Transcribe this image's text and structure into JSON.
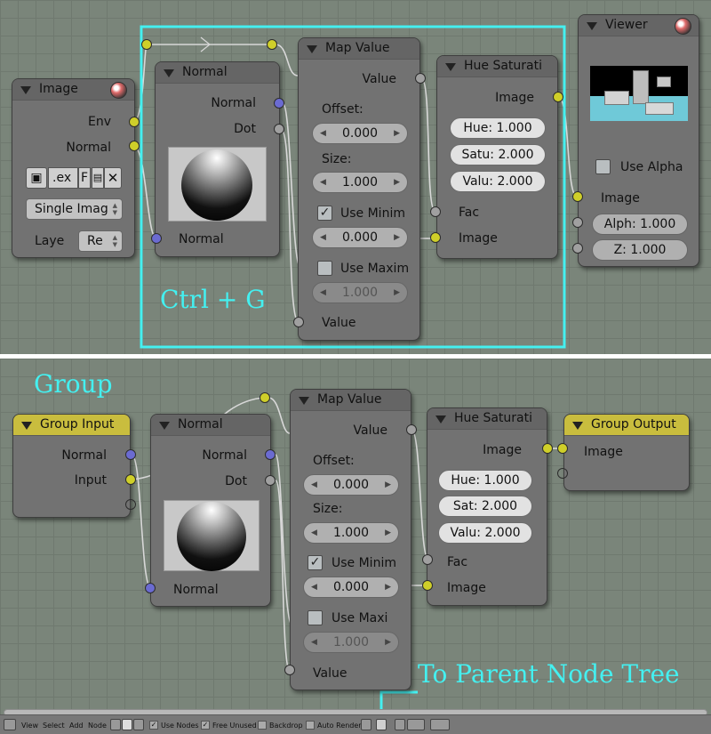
{
  "colors": {
    "annotation": "#44f0f0",
    "socket_image": "#cfcf29",
    "socket_vector": "#6b6bd1",
    "socket_value": "#a0a0a0",
    "group_node_header": "#c9bd3e"
  },
  "top": {
    "annotation": "Ctrl + G",
    "image_node": {
      "title": "Image",
      "out_env": "Env",
      "out_normal": "Normal",
      "file_name": ".ex",
      "file_flag": "F",
      "source_select": "Single Imag",
      "layer_label": "Laye",
      "layer_value": "Re"
    },
    "normal_node": {
      "title": "Normal",
      "out_normal": "Normal",
      "out_dot": "Dot",
      "in_normal": "Normal"
    },
    "map_node": {
      "title": "Map Value",
      "out_value": "Value",
      "offset_label": "Offset:",
      "offset_value": "0.000",
      "size_label": "Size:",
      "size_value": "1.000",
      "use_min_label": "Use Minim",
      "min_value": "0.000",
      "use_max_label": "Use Maxim",
      "max_value": "1.000",
      "in_value": "Value"
    },
    "hue_node": {
      "title": "Hue Saturati",
      "out_image": "Image",
      "hue": "Hue: 1.000",
      "sat": "Satu: 2.000",
      "val": "Valu: 2.000",
      "in_fac": "Fac",
      "in_image": "Image"
    },
    "viewer_node": {
      "title": "Viewer",
      "use_alpha_label": "Use Alpha",
      "in_image": "Image",
      "alpha_value": "Alph: 1.000",
      "z_value": "Z: 1.000"
    }
  },
  "bottom": {
    "group_label": "Group",
    "annotation": "To Parent Node Tree",
    "group_input": {
      "title": "Group Input",
      "out_normal": "Normal",
      "out_input": "Input"
    },
    "normal_node": {
      "title": "Normal",
      "out_normal": "Normal",
      "out_dot": "Dot",
      "in_normal": "Normal"
    },
    "map_node": {
      "title": "Map Value",
      "out_value": "Value",
      "offset_label": "Offset:",
      "offset_value": "0.000",
      "size_label": "Size:",
      "size_value": "1.000",
      "use_min_label": "Use Minim",
      "min_value": "0.000",
      "use_max_label": "Use Maxi",
      "max_value": "1.000",
      "in_value": "Value"
    },
    "hue_node": {
      "title": "Hue Saturati",
      "out_image": "Image",
      "hue": "Hue: 1.000",
      "sat": "Sat: 2.000",
      "val": "Valu: 2.000",
      "in_fac": "Fac",
      "in_image": "Image"
    },
    "group_output": {
      "title": "Group Output",
      "in_image": "Image"
    }
  },
  "statusbar": {
    "menu_view": "View",
    "menu_select": "Select",
    "menu_add": "Add",
    "menu_node": "Node",
    "use_nodes": "Use Nodes",
    "free_unused": "Free Unused",
    "backdrop": "Backdrop",
    "auto_render": "Auto Render"
  }
}
